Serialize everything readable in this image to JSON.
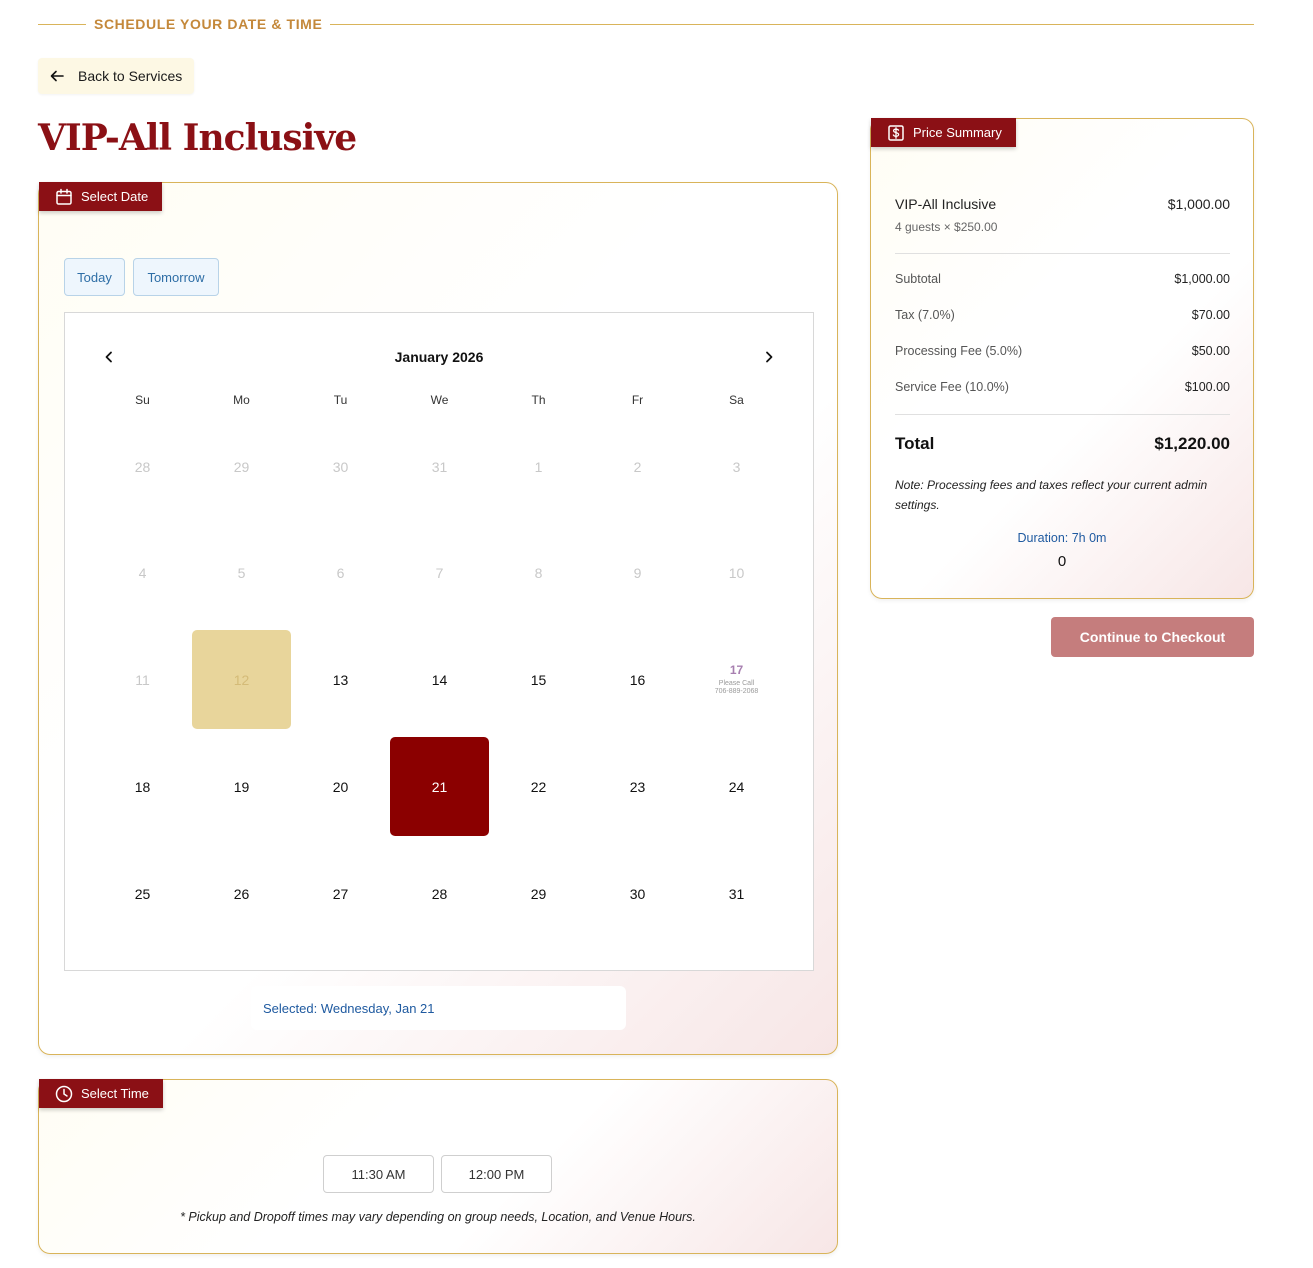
{
  "header": {
    "title": "SCHEDULE YOUR DATE & TIME"
  },
  "back_button": {
    "label": "Back to Services",
    "icon": "arrow-left-icon"
  },
  "service": {
    "title": "VIP-All Inclusive"
  },
  "date_section": {
    "tab_label": "Select Date",
    "icon": "calendar-icon",
    "quick_buttons": {
      "today": "Today",
      "tomorrow": "Tomorrow"
    },
    "calendar": {
      "month_label": "January 2026",
      "weekdays": [
        "Su",
        "Mo",
        "Tu",
        "We",
        "Th",
        "Fr",
        "Sa"
      ],
      "weeks": [
        [
          {
            "d": "28",
            "s": "muted"
          },
          {
            "d": "29",
            "s": "muted"
          },
          {
            "d": "30",
            "s": "muted"
          },
          {
            "d": "31",
            "s": "muted"
          },
          {
            "d": "1",
            "s": "muted"
          },
          {
            "d": "2",
            "s": "muted"
          },
          {
            "d": "3",
            "s": "muted"
          }
        ],
        [
          {
            "d": "4",
            "s": "muted"
          },
          {
            "d": "5",
            "s": "muted"
          },
          {
            "d": "6",
            "s": "muted"
          },
          {
            "d": "7",
            "s": "muted"
          },
          {
            "d": "8",
            "s": "muted"
          },
          {
            "d": "9",
            "s": "muted"
          },
          {
            "d": "10",
            "s": "muted"
          }
        ],
        [
          {
            "d": "11",
            "s": "muted"
          },
          {
            "d": "12",
            "s": "blocked"
          },
          {
            "d": "13",
            "s": "normal"
          },
          {
            "d": "14",
            "s": "normal"
          },
          {
            "d": "15",
            "s": "normal"
          },
          {
            "d": "16",
            "s": "normal"
          },
          {
            "d": "17",
            "s": "call",
            "note1": "Please Call",
            "note2": "706-889-2068"
          }
        ],
        [
          {
            "d": "18",
            "s": "normal"
          },
          {
            "d": "19",
            "s": "normal"
          },
          {
            "d": "20",
            "s": "normal"
          },
          {
            "d": "21",
            "s": "selected"
          },
          {
            "d": "22",
            "s": "normal"
          },
          {
            "d": "23",
            "s": "normal"
          },
          {
            "d": "24",
            "s": "normal"
          }
        ],
        [
          {
            "d": "25",
            "s": "normal"
          },
          {
            "d": "26",
            "s": "normal"
          },
          {
            "d": "27",
            "s": "normal"
          },
          {
            "d": "28",
            "s": "normal"
          },
          {
            "d": "29",
            "s": "normal"
          },
          {
            "d": "30",
            "s": "normal"
          },
          {
            "d": "31",
            "s": "normal"
          }
        ]
      ]
    },
    "selected_text": "Selected: Wednesday, Jan 21"
  },
  "time_section": {
    "tab_label": "Select Time",
    "icon": "clock-icon",
    "slots": [
      "11:30 AM",
      "12:00 PM"
    ],
    "note": "* Pickup and Dropoff times may vary depending on group needs, Location, and Venue Hours."
  },
  "price_summary": {
    "tab_label": "Price Summary",
    "icon": "dollar-icon",
    "item_name": "VIP-All Inclusive",
    "item_price": "$1,000.00",
    "item_detail": "4 guests × $250.00",
    "subtotal_label": "Subtotal",
    "subtotal_value": "$1,000.00",
    "tax_label": "Tax (7.0%)",
    "tax_value": "$70.00",
    "processing_label": "Processing Fee (5.0%)",
    "processing_value": "$50.00",
    "service_label": "Service Fee (10.0%)",
    "service_value": "$100.00",
    "total_label": "Total",
    "total_value": "$1,220.00",
    "note": "Note: Processing fees and taxes reflect your current admin settings.",
    "duration": "Duration: 7h 0m",
    "count": "0"
  },
  "checkout_button": {
    "label": "Continue to Checkout"
  },
  "colors": {
    "accent": "#8b1015",
    "gold": "#d9b45a",
    "selected_day": "#8b0000",
    "blocked_day": "#e8d59b",
    "link_blue": "#1f5aa0",
    "checkout": "#c57d7d"
  }
}
